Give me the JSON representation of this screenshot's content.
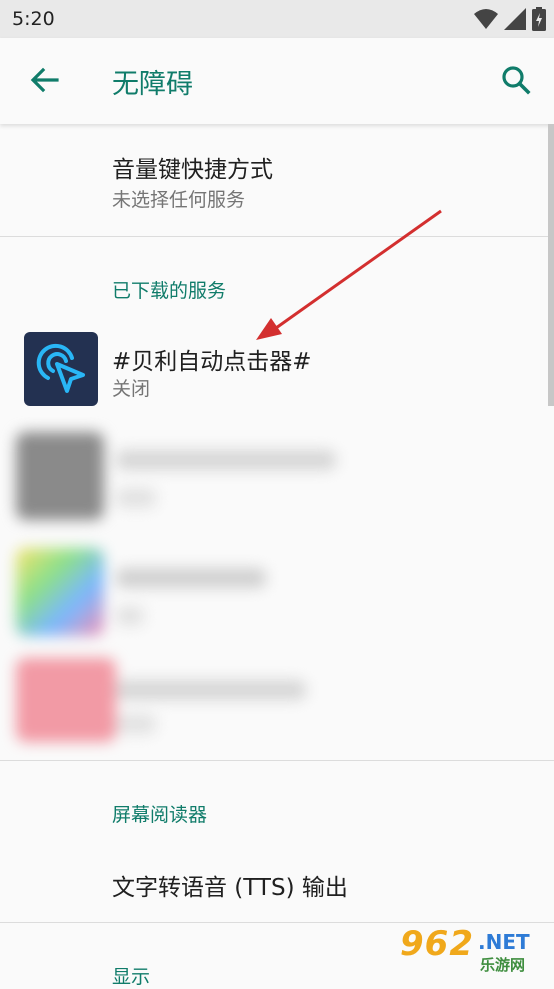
{
  "status_bar": {
    "time": "5:20",
    "icons": [
      "wifi-icon",
      "signal-icon",
      "battery-icon"
    ]
  },
  "app_bar": {
    "title": "无障碍",
    "back_icon": "arrow-left-icon",
    "search_icon": "search-icon"
  },
  "colors": {
    "accent": "#107c6a",
    "app_icon_bg": "#233151",
    "app_icon_fg": "#29b6f6",
    "annotation_arrow": "#d32f2f"
  },
  "volume_shortcut": {
    "title": "音量键快捷方式",
    "subtitle": "未选择任何服务"
  },
  "downloaded": {
    "header": "已下载的服务",
    "items": [
      {
        "title": "#贝利自动点击器#",
        "status": "关闭",
        "icon": "cursor-click-icon"
      }
    ]
  },
  "screen_reader": {
    "header": "屏幕阅读器",
    "tts_label": "文字转语音 (TTS) 输出"
  },
  "display": {
    "header": "显示"
  },
  "watermark": {
    "main": "962",
    "net": ".NET",
    "sub": "乐游网"
  }
}
